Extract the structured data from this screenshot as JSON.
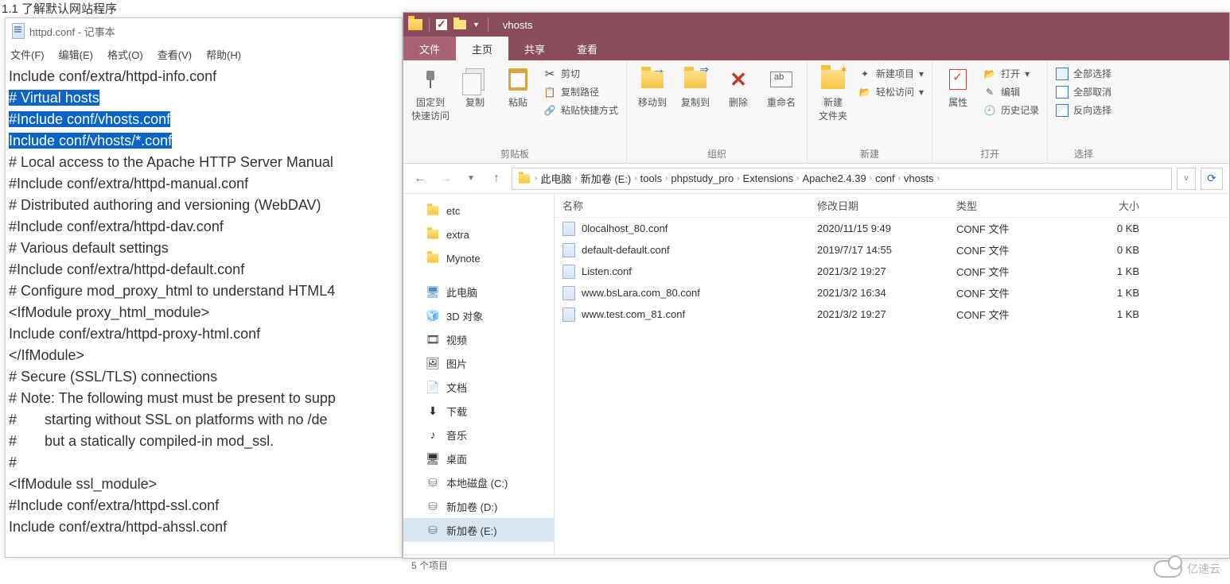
{
  "behind_title": "1.1 了解默认网站程序",
  "notepad": {
    "title": "httpd.conf - 记事本",
    "menu": [
      "文件(F)",
      "编辑(E)",
      "格式(O)",
      "查看(V)",
      "帮助(H)"
    ],
    "lines": [
      {
        "text": "Include conf/extra/httpd-info.conf",
        "sel": false
      },
      {
        "text": "# Virtual hosts",
        "sel": true
      },
      {
        "text": "#Include conf/vhosts.conf",
        "sel": true
      },
      {
        "text": "Include conf/vhosts/*.conf",
        "sel": true
      },
      {
        "text": "# Local access to the Apache HTTP Server Manual",
        "sel": false
      },
      {
        "text": "#Include conf/extra/httpd-manual.conf",
        "sel": false
      },
      {
        "text": "# Distributed authoring and versioning (WebDAV)",
        "sel": false
      },
      {
        "text": "#Include conf/extra/httpd-dav.conf",
        "sel": false
      },
      {
        "text": "# Various default settings",
        "sel": false
      },
      {
        "text": "#Include conf/extra/httpd-default.conf",
        "sel": false
      },
      {
        "text": "# Configure mod_proxy_html to understand HTML4",
        "sel": false
      },
      {
        "text": "<IfModule proxy_html_module>",
        "sel": false
      },
      {
        "text": "Include conf/extra/httpd-proxy-html.conf",
        "sel": false
      },
      {
        "text": "</IfModule>",
        "sel": false
      },
      {
        "text": "# Secure (SSL/TLS) connections",
        "sel": false
      },
      {
        "text": "# Note: The following must must be present to supp",
        "sel": false
      },
      {
        "text": "#       starting without SSL on platforms with no /de",
        "sel": false
      },
      {
        "text": "#       but a statically compiled-in mod_ssl.",
        "sel": false
      },
      {
        "text": "#",
        "sel": false
      },
      {
        "text": "<IfModule ssl_module>",
        "sel": false
      },
      {
        "text": "#Include conf/extra/httpd-ssl.conf",
        "sel": false
      },
      {
        "text": "Include conf/extra/httpd-ahssl.conf",
        "sel": false
      }
    ]
  },
  "explorer": {
    "window_title": "vhosts",
    "tabs": {
      "file": "文件",
      "home": "主页",
      "share": "共享",
      "view": "查看"
    },
    "ribbon": {
      "pin": "固定到",
      "pin2": "快速访问",
      "copy": "复制",
      "paste": "粘贴",
      "cut": "剪切",
      "copypath": "复制路径",
      "pasteshort": "粘贴快捷方式",
      "clipboard_group": "剪贴板",
      "moveto": "移动到",
      "copyto": "复制到",
      "delete": "删除",
      "rename": "重命名",
      "org_group": "组织",
      "newfolder": "新建",
      "newfolder2": "文件夹",
      "newitem": "新建项目",
      "easyaccess": "轻松访问",
      "new_group": "新建",
      "properties": "属性",
      "open": "打开",
      "edit": "编辑",
      "history": "历史记录",
      "open_group": "打开",
      "selectall": "全部选择",
      "selectnone": "全部取消",
      "invert": "反向选择",
      "select_group": "选择"
    },
    "breadcrumb": [
      "此电脑",
      "新加卷 (E:)",
      "tools",
      "phpstudy_pro",
      "Extensions",
      "Apache2.4.39",
      "conf",
      "vhosts"
    ],
    "sidebar": [
      {
        "kind": "folder",
        "label": "etc"
      },
      {
        "kind": "folder",
        "label": "extra"
      },
      {
        "kind": "folder",
        "label": "Mynote"
      },
      {
        "kind": "sep"
      },
      {
        "kind": "pc",
        "label": "此电脑"
      },
      {
        "kind": "item",
        "glyph": "🧊",
        "label": "3D 对象"
      },
      {
        "kind": "item",
        "glyph": "🎞",
        "label": "视频"
      },
      {
        "kind": "item",
        "glyph": "🖼",
        "label": "图片"
      },
      {
        "kind": "item",
        "glyph": "📄",
        "label": "文档"
      },
      {
        "kind": "item",
        "glyph": "⬇",
        "label": "下载"
      },
      {
        "kind": "item",
        "glyph": "♪",
        "label": "音乐"
      },
      {
        "kind": "item",
        "glyph": "🖥",
        "label": "桌面"
      },
      {
        "kind": "drive",
        "label": "本地磁盘 (C:)"
      },
      {
        "kind": "drive",
        "label": "新加卷 (D:)"
      },
      {
        "kind": "drive",
        "label": "新加卷 (E:)",
        "sel": true
      }
    ],
    "columns": {
      "name": "名称",
      "date": "修改日期",
      "type": "类型",
      "size": "大小"
    },
    "files": [
      {
        "name": "0localhost_80.conf",
        "date": "2020/11/15 9:49",
        "type": "CONF 文件",
        "size": "0 KB"
      },
      {
        "name": "default-default.conf",
        "date": "2019/7/17 14:55",
        "type": "CONF 文件",
        "size": "0 KB"
      },
      {
        "name": "Listen.conf",
        "date": "2021/3/2 19:27",
        "type": "CONF 文件",
        "size": "1 KB"
      },
      {
        "name": "www.bsLara.com_80.conf",
        "date": "2021/3/2 16:34",
        "type": "CONF 文件",
        "size": "1 KB"
      },
      {
        "name": "www.test.com_81.conf",
        "date": "2021/3/2 19:27",
        "type": "CONF 文件",
        "size": "1 KB"
      }
    ],
    "status": "5 个项目"
  },
  "watermark": "亿速云"
}
